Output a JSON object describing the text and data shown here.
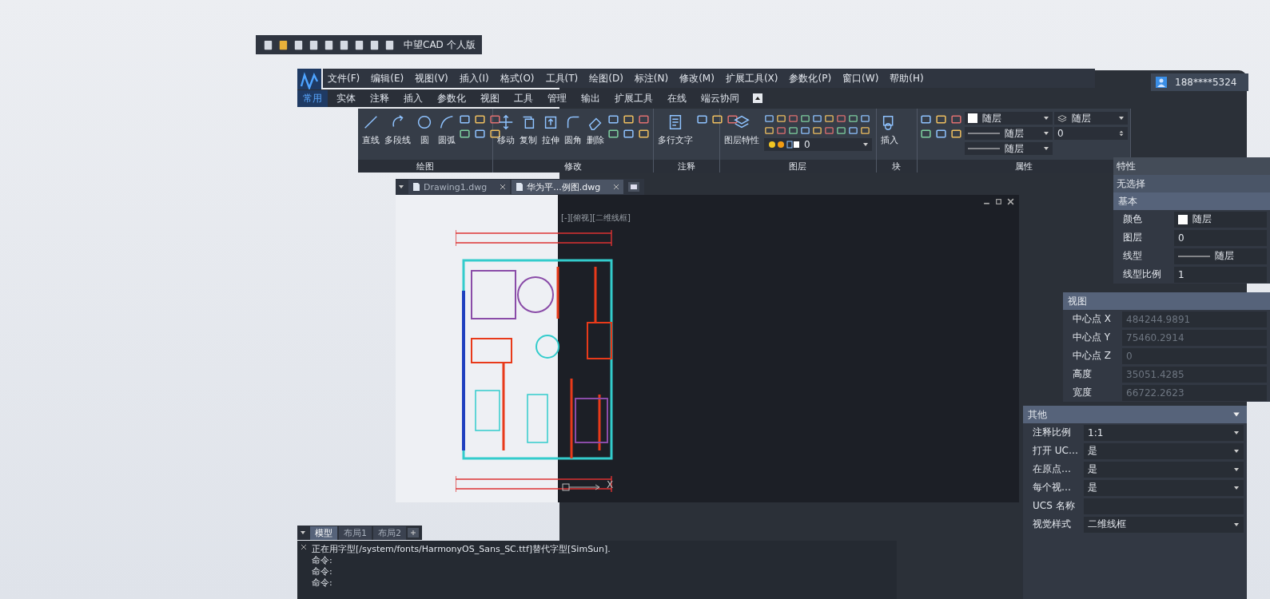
{
  "quick_access": {
    "title": "中望CAD 个人版"
  },
  "menu_bar": [
    "文件(F)",
    "编辑(E)",
    "视图(V)",
    "插入(I)",
    "格式(O)",
    "工具(T)",
    "绘图(D)",
    "标注(N)",
    "修改(M)",
    "扩展工具(X)",
    "参数化(P)",
    "窗口(W)",
    "帮助(H)"
  ],
  "ribbon_tabs": [
    {
      "label": "常用",
      "selected": true
    },
    {
      "label": "实体",
      "selected": false
    },
    {
      "label": "注释",
      "selected": false
    },
    {
      "label": "插入",
      "selected": false
    },
    {
      "label": "参数化",
      "selected": false
    },
    {
      "label": "视图",
      "selected": false
    },
    {
      "label": "工具",
      "selected": false
    },
    {
      "label": "管理",
      "selected": false
    },
    {
      "label": "输出",
      "selected": false
    },
    {
      "label": "扩展工具",
      "selected": false
    },
    {
      "label": "在线",
      "selected": false
    },
    {
      "label": "端云协同",
      "selected": false
    }
  ],
  "ribbon": {
    "groups": [
      {
        "title": "绘图",
        "kind": "tools",
        "tools": [
          "直线",
          "多段线",
          "圆",
          "圆弧"
        ]
      },
      {
        "title": "修改",
        "kind": "tools",
        "tools": [
          "移动",
          "复制",
          "拉伸",
          "圆角",
          "删除"
        ]
      },
      {
        "title": "注释",
        "kind": "tools",
        "tools": [
          "多行文字"
        ]
      },
      {
        "title": "图层",
        "kind": "layer",
        "tools": [
          "图层特性"
        ],
        "layer": "0"
      },
      {
        "title": "块",
        "kind": "tools",
        "tools": [
          "插入"
        ]
      },
      {
        "title": "属性",
        "kind": "properties",
        "dropdowns": [
          {
            "kind": "color",
            "value": "随层"
          },
          {
            "kind": "line",
            "value": "随层"
          },
          {
            "kind": "line",
            "value": "随层"
          }
        ],
        "side": [
          {
            "kind": "layer",
            "value": "随层"
          },
          {
            "kind": "spinner",
            "value": "0"
          }
        ]
      }
    ]
  },
  "user": {
    "phone": "188****5324"
  },
  "doc_tabs": [
    {
      "label": "Drawing1.dwg",
      "selected": false
    },
    {
      "label": "华为平...例图.dwg",
      "selected": true
    }
  ],
  "viewport": {
    "label": "[-][俯视][二维线框]",
    "ucs_label": "X"
  },
  "properties": {
    "title": "特性",
    "selection": "无选择",
    "section": "基本",
    "rows": [
      {
        "label": "颜色",
        "value": "随层",
        "kind": "color"
      },
      {
        "label": "图层",
        "value": "0",
        "kind": "text"
      },
      {
        "label": "线型",
        "value": "随层",
        "kind": "line"
      },
      {
        "label": "线型比例",
        "value": "1",
        "kind": "text"
      }
    ]
  },
  "view": {
    "title": "视图",
    "rows": [
      {
        "label": "中心点 X",
        "value": "484244.9891"
      },
      {
        "label": "中心点 Y",
        "value": "75460.2914"
      },
      {
        "label": "中心点 Z",
        "value": "0"
      },
      {
        "label": "高度",
        "value": "35051.4285"
      },
      {
        "label": "宽度",
        "value": "66722.2623"
      }
    ]
  },
  "other": {
    "title": "其他",
    "expanded": true,
    "rows": [
      {
        "label": "注释比例",
        "value": "1:1",
        "dropdown": true
      },
      {
        "label": "打开 UC…",
        "value": "是",
        "dropdown": true
      },
      {
        "label": "在原点…",
        "value": "是",
        "dropdown": true
      },
      {
        "label": "每个视…",
        "value": "是",
        "dropdown": true
      },
      {
        "label": "UCS 名称",
        "dropdown": false
      },
      {
        "label": "视觉样式",
        "value": "二维线框",
        "dropdown": true
      }
    ]
  },
  "layout_tabs": [
    {
      "label": "模型",
      "selected": true
    },
    {
      "label": "布局1",
      "selected": false
    },
    {
      "label": "布局2",
      "selected": false
    }
  ],
  "command_lines": [
    "正在用字型[/system/fonts/HarmonyOS_Sans_SC.ttf]替代字型[SimSun].",
    "命令:",
    "命令:",
    "命令:"
  ]
}
